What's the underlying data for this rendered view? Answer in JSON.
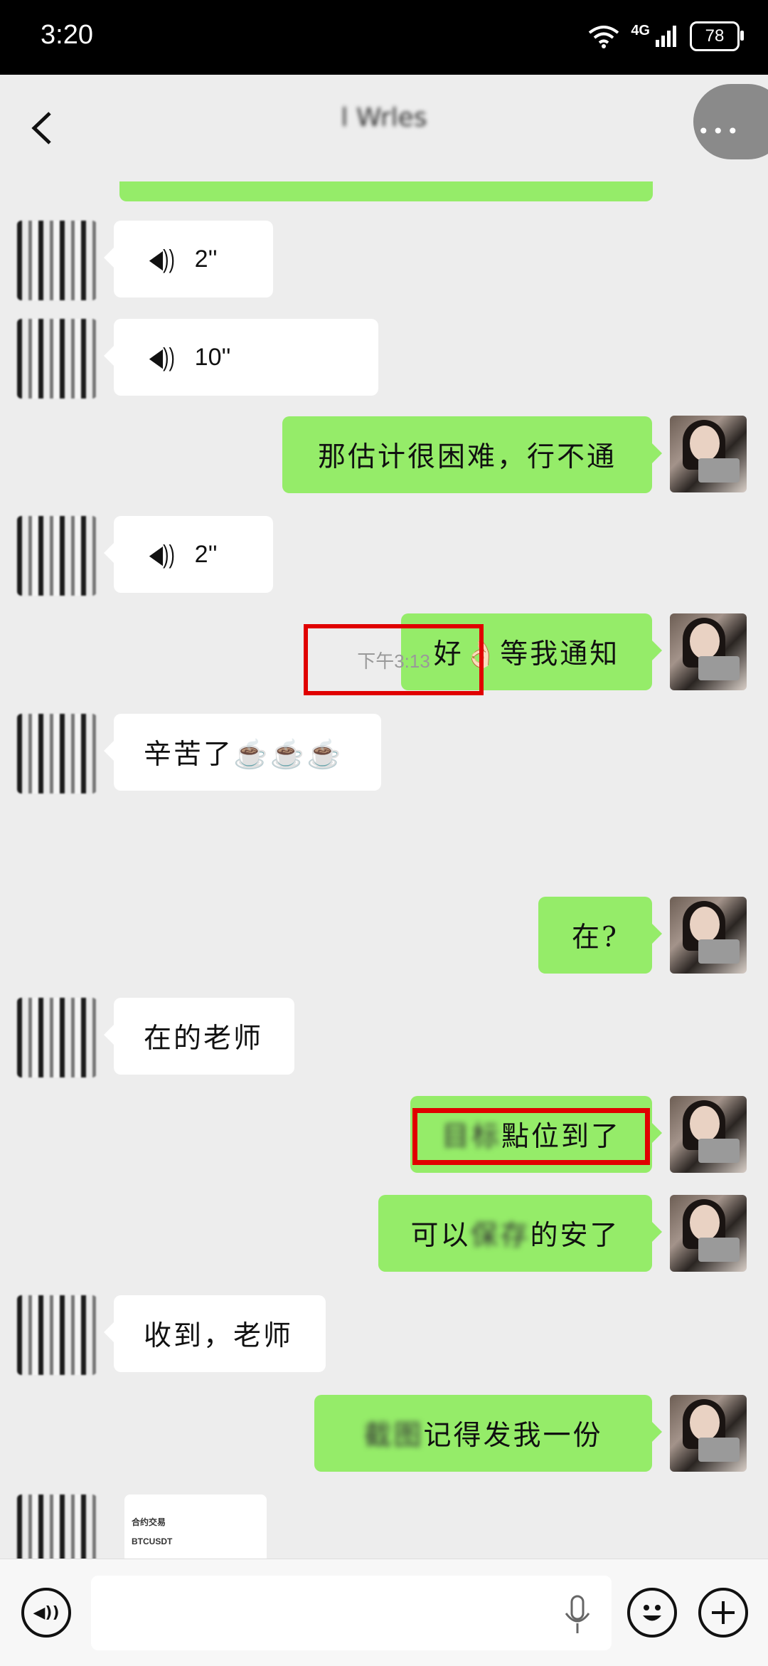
{
  "status_bar": {
    "time": "3:20",
    "network": "4G",
    "battery": "78"
  },
  "header": {
    "title": "l Wrles",
    "back_icon": "chevron-left-icon",
    "more_icon": "more-dots-icon"
  },
  "messages": [
    {
      "side": "in",
      "type": "voice",
      "text": "2''"
    },
    {
      "side": "in",
      "type": "voice",
      "text": "10''"
    },
    {
      "side": "out",
      "type": "text",
      "text": "那估计很困难，行不通"
    },
    {
      "side": "in",
      "type": "voice",
      "text": "2''"
    },
    {
      "side": "out",
      "type": "text",
      "text": "好👌🏻等我通知"
    },
    {
      "side": "in",
      "type": "text",
      "text": "辛苦了☕☕☕"
    },
    {
      "side": "system",
      "type": "time",
      "text": "下午3:13"
    },
    {
      "side": "out",
      "type": "text",
      "text": "在?"
    },
    {
      "side": "in",
      "type": "text",
      "text": "在的老师"
    },
    {
      "side": "out",
      "type": "text",
      "blurred_prefix": "目标",
      "text": "點位到了"
    },
    {
      "side": "out",
      "type": "text",
      "text_prefix": "可以",
      "blurred_prefix": "保存",
      "text": "的安了"
    },
    {
      "side": "in",
      "type": "text",
      "text": "收到，老师"
    },
    {
      "side": "out",
      "type": "text",
      "blurred_prefix": "截图",
      "text": "记得发我一份"
    },
    {
      "side": "in",
      "type": "image",
      "title": "合约交易",
      "symbol": "BTCUSDT"
    }
  ],
  "input_bar": {
    "voice_icon": "voice-mode-icon",
    "mic_icon": "microphone-icon",
    "emoji_icon": "emoji-icon",
    "plus_icon": "plus-icon"
  }
}
